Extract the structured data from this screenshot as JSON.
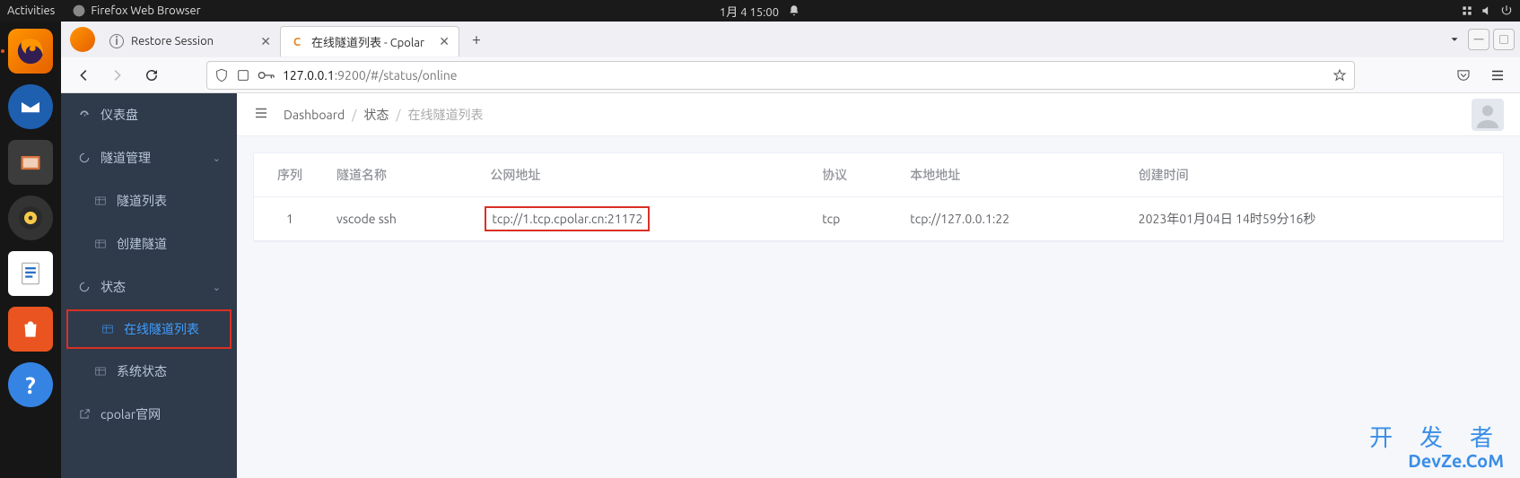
{
  "gnome": {
    "activities": "Activities",
    "app_name": "Firefox Web Browser",
    "clock": "1月 4 15:00"
  },
  "firefox": {
    "tabs": [
      {
        "title": "Restore Session",
        "active": false
      },
      {
        "title": "在线隧道列表 - Cpolar",
        "active": true,
        "favicon_letter": "C"
      }
    ],
    "url_host": "127.0.0.1",
    "url_path": ":9200/#/status/online"
  },
  "sidebar": {
    "dashboard": "仪表盘",
    "tunnel_mgmt": "隧道管理",
    "tunnel_list": "隧道列表",
    "tunnel_create": "创建隧道",
    "status": "状态",
    "online_tunnels": "在线隧道列表",
    "system_status": "系统状态",
    "cpolar_site": "cpolar官网"
  },
  "breadcrumb": {
    "dashboard": "Dashboard",
    "status": "状态",
    "current": "在线隧道列表"
  },
  "table": {
    "headers": {
      "seq": "序列",
      "name": "隧道名称",
      "public": "公网地址",
      "proto": "协议",
      "local": "本地地址",
      "created": "创建时间"
    },
    "rows": [
      {
        "seq": "1",
        "name": "vscode ssh",
        "public": "tcp://1.tcp.cpolar.cn:21172",
        "proto": "tcp",
        "local": "tcp://127.0.0.1:22",
        "created": "2023年01月04日 14时59分16秒"
      }
    ]
  },
  "watermark": {
    "line1": "开 发 者",
    "line2": "DevZe.CoM"
  }
}
